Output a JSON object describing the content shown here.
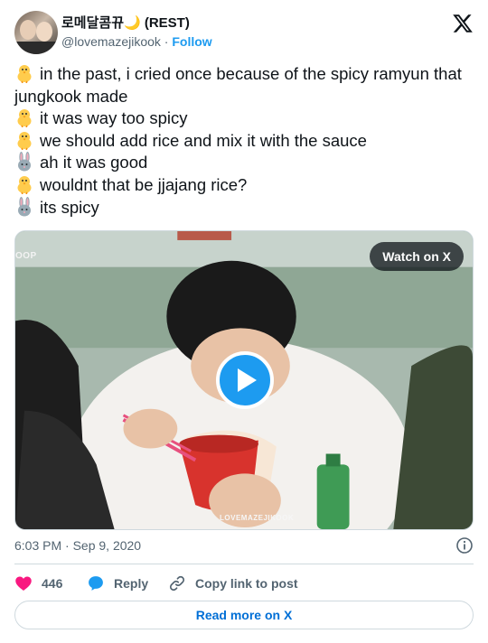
{
  "author": {
    "display_name": "로메달콤뀨🌙 (REST)",
    "handle": "@lovemazejikook",
    "separator": " · ",
    "follow_label": "Follow"
  },
  "tweet": {
    "lines": [
      {
        "icon": "chick-emoji",
        "text": "in the past, i cried once because of  the spicy ramyun that jungkook made"
      },
      {
        "icon": "chick-emoji",
        "text": "it was way too spicy"
      },
      {
        "icon": "chick-emoji",
        "text": "we should add rice and mix it with the sauce"
      },
      {
        "icon": "rabbit-emoji",
        "text": "ah it was good"
      },
      {
        "icon": "chick-emoji",
        "text": "wouldnt that be jjajang rice?"
      },
      {
        "icon": "rabbit-emoji",
        "text": "its spicy"
      }
    ]
  },
  "media": {
    "watch_label": "Watch on X",
    "watermark_top": "OOP",
    "watermark_bottom": "LOVEMAZEJIKOOK"
  },
  "timestamp": "6:03 PM · Sep 9, 2020",
  "actions": {
    "like_count": "446",
    "reply_label": "Reply",
    "copy_label": "Copy link to post"
  },
  "read_more_label": "Read more on X",
  "colors": {
    "accent": "#1d9bf0",
    "like": "#f91880",
    "link": "#006fd6",
    "muted": "#536471"
  }
}
